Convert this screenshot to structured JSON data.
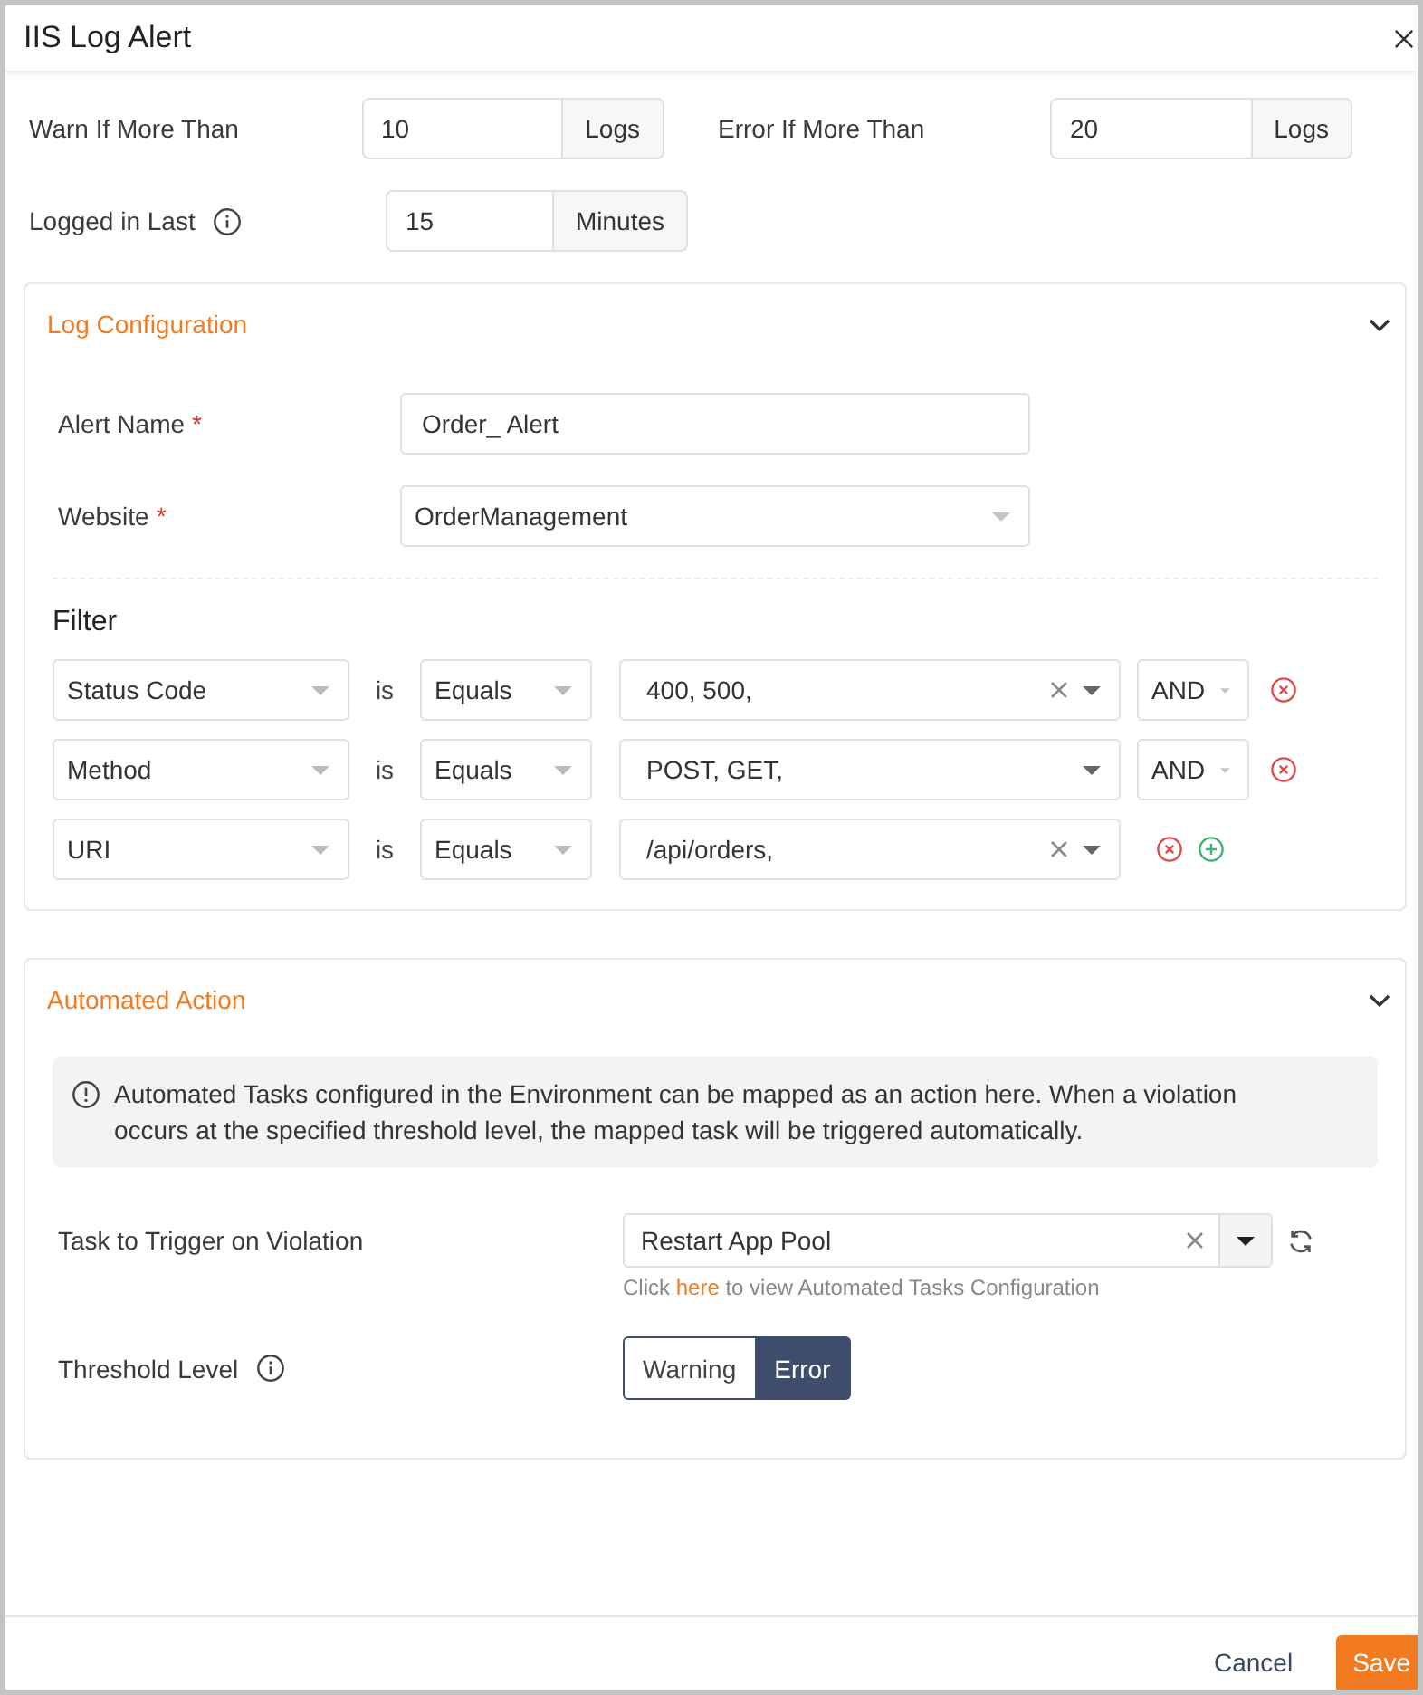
{
  "dialog": {
    "title": "IIS Log Alert"
  },
  "thresholds": [
    {
      "label": "Warn If More Than",
      "value": "10",
      "unit": "Logs"
    },
    {
      "label": "Error If More Than",
      "value": "20",
      "unit": "Logs"
    }
  ],
  "time_window": {
    "label": "Logged in Last",
    "value": "15",
    "unit": "Minutes"
  },
  "log_configuration": {
    "title": "Log Configuration",
    "expanded": true,
    "fields": [
      {
        "kind": "text",
        "label": "Alert Name",
        "required_mark": "*",
        "value": "Order_ Alert"
      },
      {
        "kind": "select",
        "label": "Website",
        "required_mark": "*",
        "value": "OrderManagement"
      }
    ],
    "filter": {
      "title": "Filter",
      "rows": [
        {
          "field": "Status Code",
          "relation": "is",
          "operator": "Equals",
          "value": "400, 500,",
          "clearable": true,
          "conjunction": "AND",
          "addable": false
        },
        {
          "field": "Method",
          "relation": "is",
          "operator": "Equals",
          "value": "POST, GET,",
          "clearable": false,
          "conjunction": "AND",
          "addable": false
        },
        {
          "field": "URI",
          "relation": "is",
          "operator": "Equals",
          "value": "/api/orders,",
          "clearable": true,
          "addable": true
        }
      ]
    }
  },
  "automated_action": {
    "title": "Automated Action",
    "expanded": true,
    "notice": "Automated Tasks configured in the Environment can be mapped as an action here. When a violation occurs at the specified threshold level, the mapped task will be triggered automatically.",
    "task": {
      "label": "Task to Trigger on Violation",
      "value": "Restart App Pool",
      "help": {
        "before": "Click",
        "link": "here",
        "after": "to view Automated Tasks Configuration"
      }
    },
    "threshold": {
      "label": "Threshold Level",
      "options": [
        {
          "label": "Warning",
          "selected": false
        },
        {
          "label": "Error",
          "selected": true
        }
      ]
    }
  },
  "footer": {
    "buttons": [
      {
        "kind": "link",
        "label": "Cancel"
      },
      {
        "kind": "primary",
        "label": "Save"
      }
    ]
  }
}
